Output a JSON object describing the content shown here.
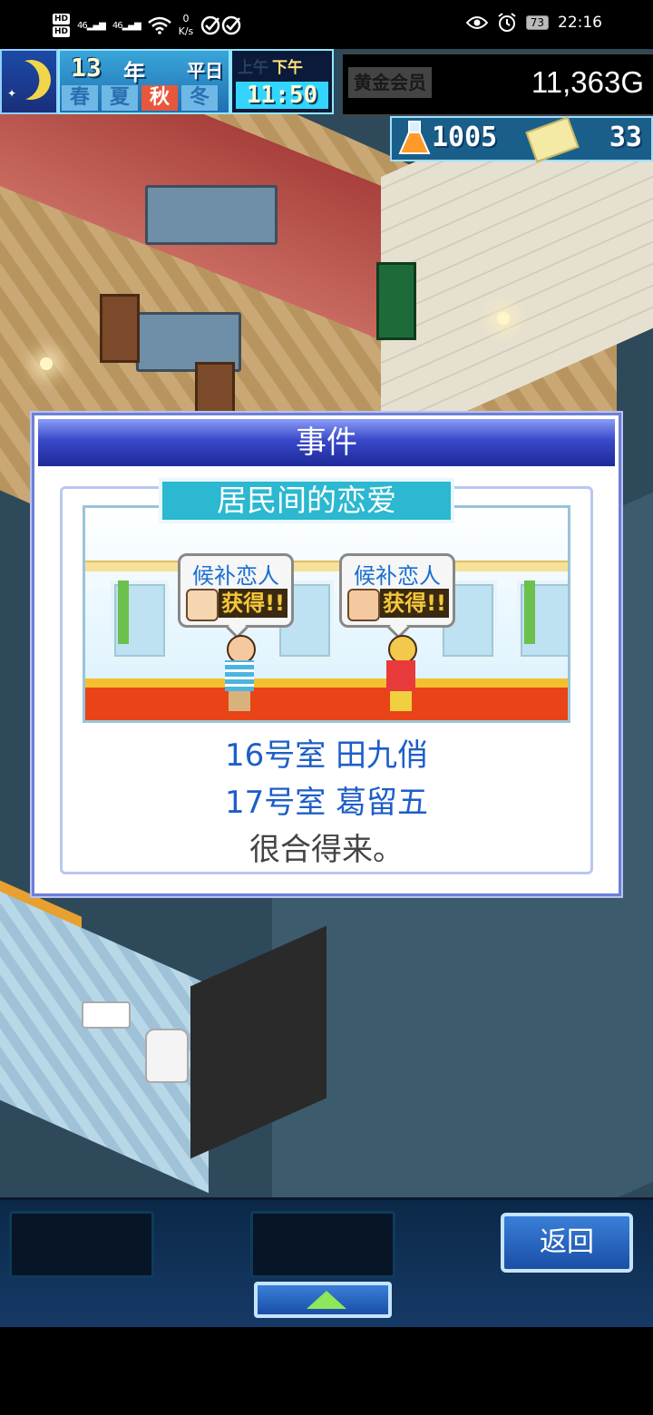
{
  "status_bar": {
    "hd1": "HD",
    "hd2": "HD",
    "signal1": "46",
    "signal2": "46",
    "net_speed_value": "0",
    "net_speed_unit": "K/s",
    "battery": "73",
    "time": "22:16",
    "icons": [
      "wifi-icon",
      "check-circle-icon",
      "eye-icon",
      "alarm-icon"
    ]
  },
  "hud": {
    "year": "13",
    "year_label": "年",
    "day_type": "平日",
    "seasons": [
      "春",
      "夏",
      "秋",
      "冬"
    ],
    "active_season": "秋",
    "am_label": "上午",
    "pm_label": "下午",
    "clock": "11:50",
    "member_label": "黄金会员",
    "money": "11,363G",
    "research_points": "1005",
    "tickets": "33"
  },
  "dialog": {
    "title": "事件",
    "banner": "居民间的恋爱",
    "bubble_title": "候补恋人",
    "bubble_badge": "获得!!",
    "line1": "16号室 田九俏",
    "line2": "17号室 葛留五",
    "line3": "很合得来。"
  },
  "bottom": {
    "back_label": "返回"
  },
  "colors": {
    "dialog_header": "#2a3ab0",
    "accent_blue": "#1d5ec8",
    "banner": "#2bb8d0",
    "active_season": "#e8573c"
  }
}
